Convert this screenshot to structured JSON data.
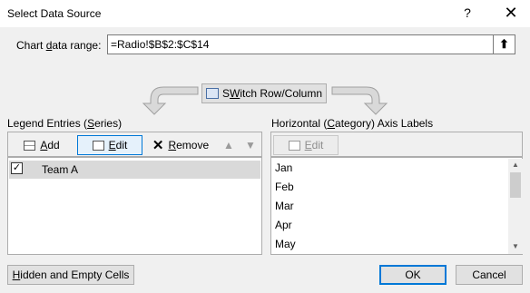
{
  "window": {
    "title": "Select Data Source",
    "help_glyph": "?",
    "close_glyph": "✕"
  },
  "range": {
    "label_prefix": "Chart ",
    "label_accel": "d",
    "label_suffix": "ata range:",
    "value": "=Radio!$B$2:$C$14",
    "collapse_glyph": "⬆"
  },
  "switch": {
    "accel": "W",
    "label_rest": "itch Row/Column",
    "label_prefix": "S"
  },
  "legend": {
    "title_prefix": "Legend Entries (",
    "title_accel": "S",
    "title_suffix": "eries)",
    "add_accel": "A",
    "add_rest": "dd",
    "edit_accel": "E",
    "edit_rest": "dit",
    "remove_accel": "R",
    "remove_rest": "emove",
    "up_glyph": "▲",
    "down_glyph": "▼",
    "series": [
      {
        "label": "Team A",
        "checked": true,
        "check_glyph": "✓"
      }
    ]
  },
  "axis": {
    "title_prefix": "Horizontal (",
    "title_accel": "C",
    "title_suffix": "ategory) Axis Labels",
    "edit_accel": "E",
    "edit_rest": "dit",
    "items": [
      "Jan",
      "Feb",
      "Mar",
      "Apr",
      "May"
    ],
    "scroll_up_glyph": "▲",
    "scroll_down_glyph": "▼"
  },
  "buttons": {
    "hidden_accel": "H",
    "hidden_rest": "idden and Empty Cells",
    "ok": "OK",
    "cancel": "Cancel"
  },
  "colors": {
    "accent": "#0078d7",
    "selected_row": "#d9d9d9",
    "dialog_bg": "#f0f0f0"
  }
}
